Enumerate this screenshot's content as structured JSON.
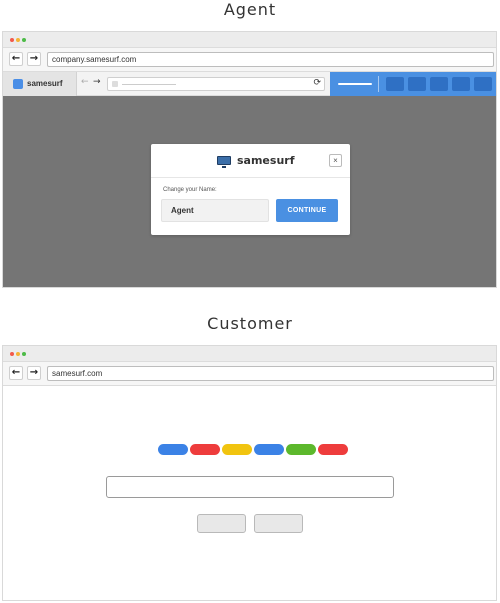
{
  "agent_section": {
    "title": "Agent",
    "browser_url": "company.samesurf.com",
    "brand_name": "samesurf",
    "modal": {
      "brand": "samesurf",
      "close_label": "×",
      "field_label": "Change your Name:",
      "name_value": "Agent",
      "continue_label": "CONTINUE"
    }
  },
  "customer_section": {
    "title": "Customer",
    "browser_url": "samesurf.com",
    "logo_pill_colors": [
      "#3b82e6",
      "#ee3c3c",
      "#f1c40f",
      "#3b82e6",
      "#5cb82c",
      "#ee3c3c"
    ]
  },
  "icons": {
    "back": "←",
    "forward": "→",
    "reload": "⟳"
  },
  "colors": {
    "accent_blue": "#4a90e2",
    "overlay_gray": "#757575",
    "dot_red": "#f25a4b",
    "dot_yellow": "#f5b335",
    "dot_green": "#4cbb47"
  }
}
